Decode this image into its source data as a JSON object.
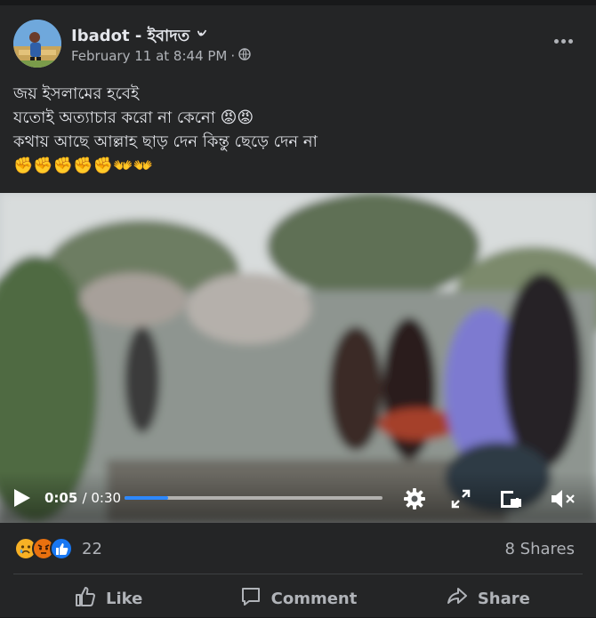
{
  "post": {
    "author": "Ibadot - ইবাদত ৺",
    "timestamp": "February 11 at 8:44 PM",
    "separator": "·",
    "privacy_icon": "globe-icon",
    "lines": [
      "জয় ইসলামের হবেই",
      "যতোই অত্যাচার করো না কেনো 😡😡",
      "কথায় আছে আল্লাহ ছাড় দেন কিন্তু ছেড়ে দেন না",
      "✊✊✊✊✊👐👐"
    ]
  },
  "video": {
    "current_time": "0:05",
    "duration": "/ 0:30",
    "progress": 0.17,
    "play_icon": "play-icon",
    "settings_icon": "gear-icon",
    "fullscreen_icon": "expand-icon",
    "pip_icon": "picture-in-picture-icon",
    "volume_icon": "volume-muted-icon"
  },
  "engagement": {
    "reaction_icons": [
      "sad-reaction-icon",
      "angry-reaction-icon",
      "like-reaction-icon"
    ],
    "reaction_count": "22",
    "shares": "8 Shares"
  },
  "actions": {
    "like": "Like",
    "comment": "Comment",
    "share": "Share"
  },
  "colors": {
    "background": "#242526",
    "text": "#e4e6eb",
    "secondary_text": "#b0b3b8",
    "progress": "#2d88ff",
    "like_blue": "#1877f2",
    "angry": "#e9710f",
    "sad": "#f7b125"
  }
}
